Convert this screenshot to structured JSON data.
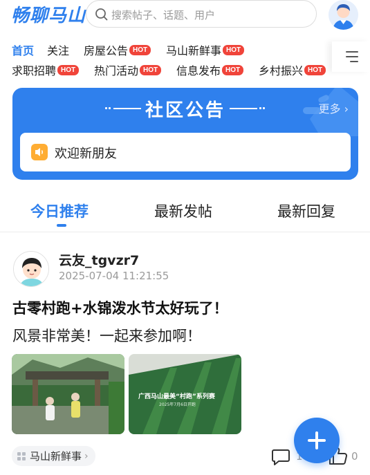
{
  "header": {
    "logo": "畅聊马山",
    "search_placeholder": "搜索帖子、话题、用户"
  },
  "categories": {
    "row1": [
      {
        "label": "首页",
        "hot": false,
        "active": true
      },
      {
        "label": "关注",
        "hot": false,
        "active": false
      },
      {
        "label": "房屋公告",
        "hot": true,
        "active": false
      },
      {
        "label": "马山新鲜事",
        "hot": true,
        "active": false
      }
    ],
    "row2": [
      {
        "label": "求职招聘",
        "hot": true,
        "active": false
      },
      {
        "label": "热门活动",
        "hot": true,
        "active": false
      },
      {
        "label": "信息发布",
        "hot": true,
        "active": false
      },
      {
        "label": "乡村振兴",
        "hot": true,
        "active": false
      }
    ],
    "hot_label": "HOT"
  },
  "notice": {
    "title": "社区公告",
    "more": "更多",
    "text": "欢迎新朋友"
  },
  "tabs": [
    {
      "label": "今日推荐",
      "active": true
    },
    {
      "label": "最新发帖",
      "active": false
    },
    {
      "label": "最新回复",
      "active": false
    }
  ],
  "post": {
    "username": "云友_tgvzr7",
    "time": "2025-07-04 11:21:55",
    "title": "古零村跑+水锦泼水节太好玩了！",
    "body": "风景非常美！一起来参加啊！",
    "image_caption": "广西马山最美“村跑”系列赛",
    "image_subcaption": "2025年7月6日开跑",
    "tag": "马山新鲜事",
    "comments": "1",
    "likes": "0"
  },
  "colors": {
    "accent": "#2f80ed",
    "hot": "#f0443a",
    "speaker": "#ffad33"
  }
}
